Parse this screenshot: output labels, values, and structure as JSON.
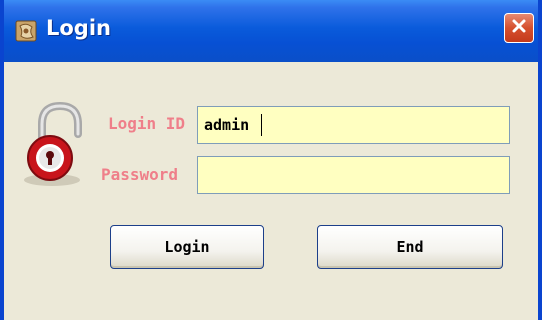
{
  "window": {
    "title": "Login",
    "close_icon": "close-icon",
    "app_icon": "app-icon"
  },
  "form": {
    "login_id_label": "Login ID",
    "login_id_value": "admin",
    "password_label": "Password",
    "password_value": "",
    "lock_icon": "padlock-icon"
  },
  "buttons": {
    "login_label": "Login",
    "end_label": "End"
  },
  "colors": {
    "titlebar": "#0a5bdb",
    "label": "#ef7f8a",
    "field_background": "#ffffc1",
    "window_background": "#ece9d8"
  }
}
